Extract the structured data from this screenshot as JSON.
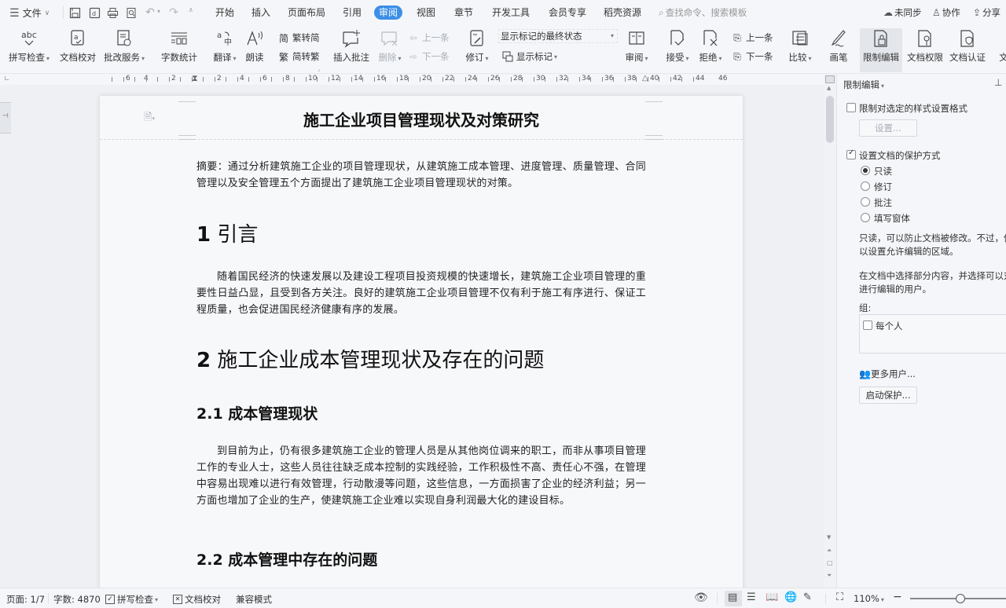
{
  "menubar": {
    "file_label": "文件",
    "tabs": [
      "开始",
      "插入",
      "页面布局",
      "引用",
      "审阅",
      "视图",
      "章节",
      "开发工具",
      "会员专享",
      "稻壳资源"
    ],
    "active_tab": "审阅",
    "search_placeholder": "查找命令、搜索模板",
    "sync_label": "未同步",
    "collab_label": "协作",
    "share_label": "分享"
  },
  "ribbon": {
    "spell_check": "拼写检查",
    "doc_proof": "文档校对",
    "correction_service": "批改服务",
    "word_count": "字数统计",
    "translate": "翻译",
    "read_aloud": "朗读",
    "trad_to_simp": "繁转简",
    "simp_to_trad": "简转繁",
    "insert_comment": "插入批注",
    "delete": "删除",
    "prev_comment": "上一条",
    "next_comment": "下一条",
    "track_changes": "修订",
    "markup_state": "显示标记的最终状态",
    "show_markup": "显示标记",
    "review": "审阅",
    "accept": "接受",
    "reject": "拒绝",
    "prev_change": "上一条",
    "next_change": "下一条",
    "compare": "比较",
    "ink": "画笔",
    "restrict_editing": "限制编辑",
    "doc_permission": "文档权限",
    "doc_certify": "文档认证",
    "doc_more": "文"
  },
  "ruler": {
    "left_ticks": [
      "6",
      "4",
      "2"
    ],
    "right_ticks": [
      "2",
      "4",
      "6",
      "8",
      "10",
      "12",
      "14",
      "16",
      "18",
      "20",
      "22",
      "24",
      "26",
      "28",
      "30",
      "32",
      "34",
      "36",
      "38",
      "40",
      "42",
      "44",
      "46"
    ]
  },
  "document": {
    "title": "施工企业项目管理现状及对策研究",
    "abstract": "摘要：通过分析建筑施工企业的项目管理现状，从建筑施工成本管理、进度管理、质量管理、合同管理以及安全管理五个方面提出了建筑施工企业项目管理现状的对策。",
    "h1_1_num": "1",
    "h1_1_text": "引言",
    "para_1": "随着国民经济的快速发展以及建设工程项目投资规模的快速增长，建筑施工企业项目管理的重要性日益凸显，且受到各方关注。良好的建筑施工企业项目管理不仅有利于施工有序进行、保证工程质量，也会促进国民经济健康有序的发展。",
    "h1_2_num": "2",
    "h1_2_text": "施工企业成本管理现状及存在的问题",
    "h2_1": "2.1 成本管理现状",
    "para_2": "到目前为止，仍有很多建筑施工企业的管理人员是从其他岗位调来的职工，而非从事项目管理工作的专业人士，这些人员往往缺乏成本控制的实践经验，工作积极性不高、责任心不强，在管理中容易出现难以进行有效管理，行动散漫等问题，这些信息，一方面损害了企业的经济利益；另一方面也增加了企业的生产，使建筑施工企业难以实现自身利润最大化的建设目标。",
    "h2_2": "2.2 成本管理中存在的问题"
  },
  "pane": {
    "title": "限制编辑",
    "restrict_format_label": "限制对选定的样式设置格式",
    "restrict_format_checked": false,
    "settings_button": "设置...",
    "protect_label": "设置文档的保护方式",
    "protect_checked": true,
    "options": [
      "只读",
      "修订",
      "批注",
      "填写窗体"
    ],
    "selected_option": "只读",
    "desc_1_line1": "只读，可以防止文档被修改。不过，你",
    "desc_1_line2": "以设置允许编辑的区域。",
    "desc_2_line1": "在文档中选择部分内容，并选择可以对",
    "desc_2_line2": "进行编辑的用户。",
    "group_label": "组:",
    "everyone_label": "每个人",
    "everyone_checked": false,
    "more_users": "更多用户...",
    "start_protect_button": "启动保护..."
  },
  "status": {
    "page": "页面: 1/7",
    "word_count": "字数: 4870",
    "spell_check": "拼写检查",
    "doc_proof": "文档校对",
    "compat_mode": "兼容模式",
    "zoom": "110%",
    "zoom_slider_value_percent": 110
  },
  "colors": {
    "accent": "#3c8fe6",
    "background": "#f4f6f9",
    "page": "#f7f8fa"
  }
}
